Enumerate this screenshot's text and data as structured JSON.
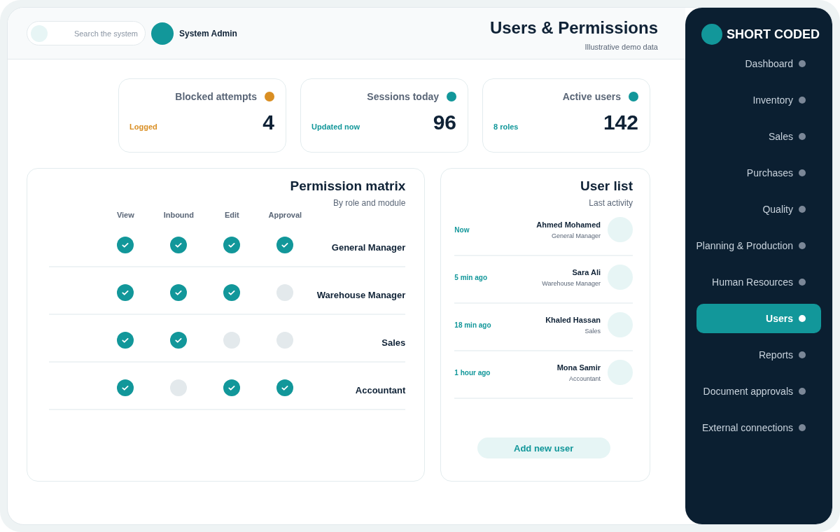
{
  "header": {
    "search": {
      "placeholder": "Search the system"
    },
    "user": {
      "name": "System Admin"
    },
    "title": "Users & Permissions",
    "subtitle": "Illustrative demo data"
  },
  "stats": [
    {
      "label": "Blocked attempts",
      "value": "4",
      "note": "Logged",
      "color": "#d98e22"
    },
    {
      "label": "Sessions today",
      "value": "96",
      "note": "Updated now",
      "color": "#12979a"
    },
    {
      "label": "Active users",
      "value": "142",
      "note": "8 roles",
      "color": "#12979a"
    }
  ],
  "permission_matrix": {
    "title": "Permission matrix",
    "subtitle": "By role and module",
    "columns": [
      "View",
      "Inbound",
      "Edit",
      "Approval"
    ],
    "rows": [
      {
        "role": "General Manager",
        "permissions": [
          true,
          true,
          true,
          true
        ]
      },
      {
        "role": "Warehouse Manager",
        "permissions": [
          true,
          true,
          true,
          false
        ]
      },
      {
        "role": "Sales",
        "permissions": [
          true,
          true,
          false,
          false
        ]
      },
      {
        "role": "Accountant",
        "permissions": [
          true,
          false,
          true,
          true
        ]
      }
    ]
  },
  "user_list": {
    "title": "User list",
    "subtitle": "Last activity",
    "users": [
      {
        "name": "Ahmed Mohamed",
        "role": "General Manager",
        "last_active": "Now"
      },
      {
        "name": "Sara Ali",
        "role": "Warehouse Manager",
        "last_active": "5 min ago"
      },
      {
        "name": "Khaled Hassan",
        "role": "Sales",
        "last_active": "18 min ago"
      },
      {
        "name": "Mona Samir",
        "role": "Accountant",
        "last_active": "1 hour ago"
      }
    ],
    "add_button": "Add new user"
  },
  "sidebar": {
    "logo": "SHORT CODED",
    "items": [
      {
        "label": "Dashboard",
        "selected": false
      },
      {
        "label": "Inventory",
        "selected": false
      },
      {
        "label": "Sales",
        "selected": false
      },
      {
        "label": "Purchases",
        "selected": false
      },
      {
        "label": "Quality",
        "selected": false
      },
      {
        "label": "Planning & Production",
        "selected": false
      },
      {
        "label": "Human Resources",
        "selected": false
      },
      {
        "label": "Users",
        "selected": true
      },
      {
        "label": "Reports",
        "selected": false
      },
      {
        "label": "Document approvals",
        "selected": false
      },
      {
        "label": "External connections",
        "selected": false
      }
    ]
  }
}
